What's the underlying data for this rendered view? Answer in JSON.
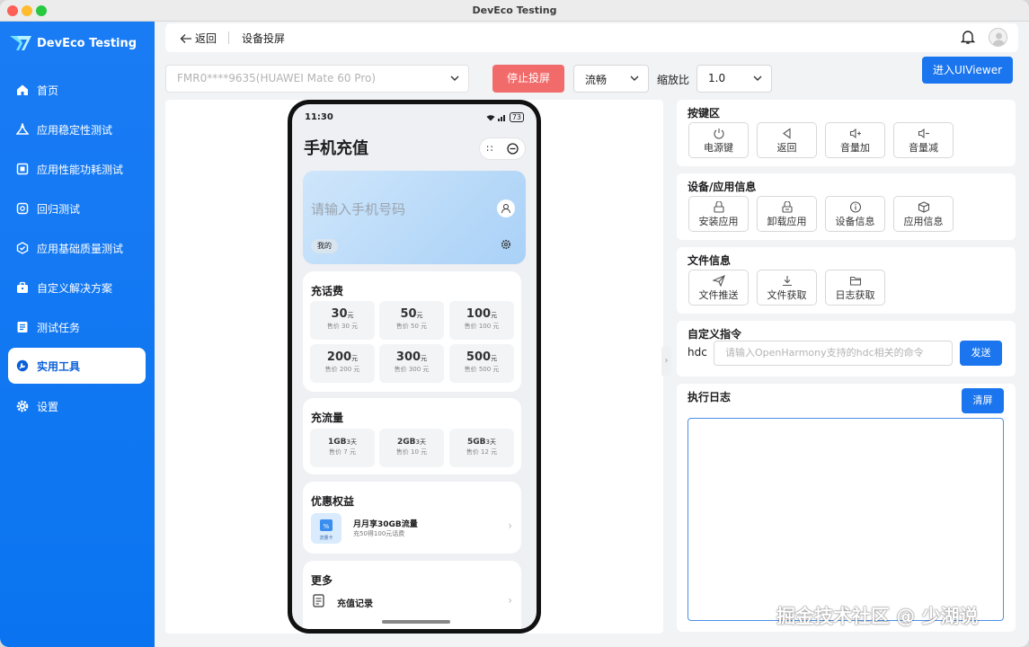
{
  "window": {
    "title": "DevEco Testing"
  },
  "sidebar": {
    "brand": "DevEco Testing",
    "items": [
      {
        "label": "首页",
        "icon": "home-icon"
      },
      {
        "label": "应用稳定性测试",
        "icon": "stability-icon"
      },
      {
        "label": "应用性能功耗测试",
        "icon": "performance-icon"
      },
      {
        "label": "回归测试",
        "icon": "regression-icon"
      },
      {
        "label": "应用基础质量测试",
        "icon": "quality-icon"
      },
      {
        "label": "自定义解决方案",
        "icon": "briefcase-icon"
      },
      {
        "label": "测试任务",
        "icon": "task-list-icon"
      },
      {
        "label": "实用工具",
        "icon": "wrench-icon",
        "active": true
      },
      {
        "label": "设置",
        "icon": "gear-icon"
      }
    ]
  },
  "header": {
    "back_label": "返回",
    "title": "设备投屏"
  },
  "toolbar": {
    "device": "FMR0****9635(HUAWEI Mate 60 Pro)",
    "stop_label": "停止投屏",
    "quality": "流畅",
    "zoom_label": "缩放比",
    "zoom_value": "1.0",
    "uiviewer_label": "进入UIViewer"
  },
  "phone": {
    "time": "11:30",
    "battery": "73",
    "app_title": "手机充值",
    "capsule_more": "∷",
    "phone_placeholder": "请输入手机号码",
    "mine_label": "我的",
    "call_fee": {
      "title": "充话费",
      "unit": "元",
      "items": [
        {
          "amount": "30",
          "price": "售价 30 元"
        },
        {
          "amount": "50",
          "price": "售价 50 元"
        },
        {
          "amount": "100",
          "price": "售价 100 元"
        },
        {
          "amount": "200",
          "price": "售价 200 元"
        },
        {
          "amount": "300",
          "price": "售价 300 元"
        },
        {
          "amount": "500",
          "price": "售价 500 元"
        }
      ]
    },
    "data_plan": {
      "title": "充流量",
      "unit": "3天",
      "items": [
        {
          "amount": "1GB",
          "price": "售价 7 元"
        },
        {
          "amount": "2GB",
          "price": "售价 10 元"
        },
        {
          "amount": "5GB",
          "price": "售价 12 元"
        }
      ]
    },
    "benefits": {
      "title": "优惠权益",
      "badge": "流量卡",
      "item_title": "月月享30GB流量",
      "item_sub": "充50得100元话费"
    },
    "more": {
      "title": "更多",
      "item": "充值记录"
    }
  },
  "panels": {
    "keys": {
      "title": "按键区",
      "buttons": [
        {
          "label": "电源键",
          "icon": "power-icon"
        },
        {
          "label": "返回",
          "icon": "back-triangle-icon"
        },
        {
          "label": "音量加",
          "icon": "volume-up-icon"
        },
        {
          "label": "音量减",
          "icon": "volume-down-icon"
        }
      ]
    },
    "device_info": {
      "title": "设备/应用信息",
      "buttons": [
        {
          "label": "安装应用",
          "icon": "install-icon"
        },
        {
          "label": "卸载应用",
          "icon": "uninstall-icon"
        },
        {
          "label": "设备信息",
          "icon": "info-icon"
        },
        {
          "label": "应用信息",
          "icon": "package-icon"
        }
      ]
    },
    "file_info": {
      "title": "文件信息",
      "buttons": [
        {
          "label": "文件推送",
          "icon": "send-icon"
        },
        {
          "label": "文件获取",
          "icon": "download-icon"
        },
        {
          "label": "日志获取",
          "icon": "folder-icon"
        }
      ]
    },
    "custom_cmd": {
      "title": "自定义指令",
      "prefix": "hdc",
      "placeholder": "请输入OpenHarmony支持的hdc相关的命令",
      "send_label": "发送"
    },
    "log": {
      "title": "执行日志",
      "clear_label": "清屏",
      "content": ""
    }
  },
  "watermark": "掘金技术社区 @ 少湖说",
  "colors": {
    "accent": "#1a75ee",
    "danger": "#f26b6b",
    "sidebar": "#0a74f0"
  }
}
